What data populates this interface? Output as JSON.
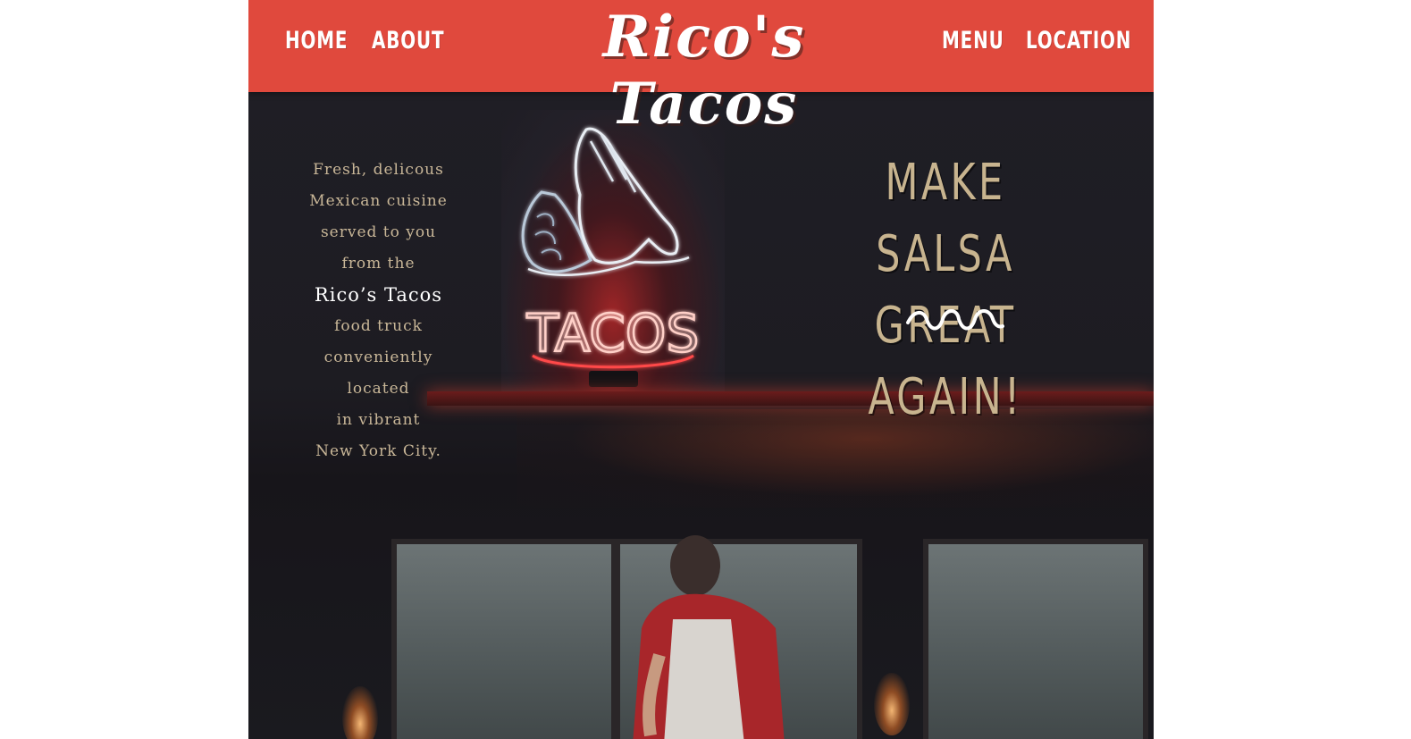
{
  "header": {
    "nav_left": [
      {
        "label": "Home"
      },
      {
        "label": "About"
      }
    ],
    "brand": "Rico's Tacos",
    "nav_right": [
      {
        "label": "Menu"
      },
      {
        "label": "Location"
      }
    ],
    "color": "#e0493d"
  },
  "hero": {
    "intro_lines": [
      "Fresh, delicous",
      "Mexican cuisine",
      "served to you",
      "from the"
    ],
    "intro_highlight": "Rico’s Tacos",
    "intro_lines_after": [
      "food truck",
      "conveniently",
      "located",
      "in vibrant",
      "New York City."
    ],
    "slogan_line1": "Make Salsa",
    "slogan_line2": "Great Again!",
    "sign_text": "TACOS",
    "divider_icon": "wave-squiggle-icon",
    "colors": {
      "text_tan": "#c9b798",
      "highlight": "#ffffff",
      "neon_red": "#ff3a3a"
    }
  }
}
